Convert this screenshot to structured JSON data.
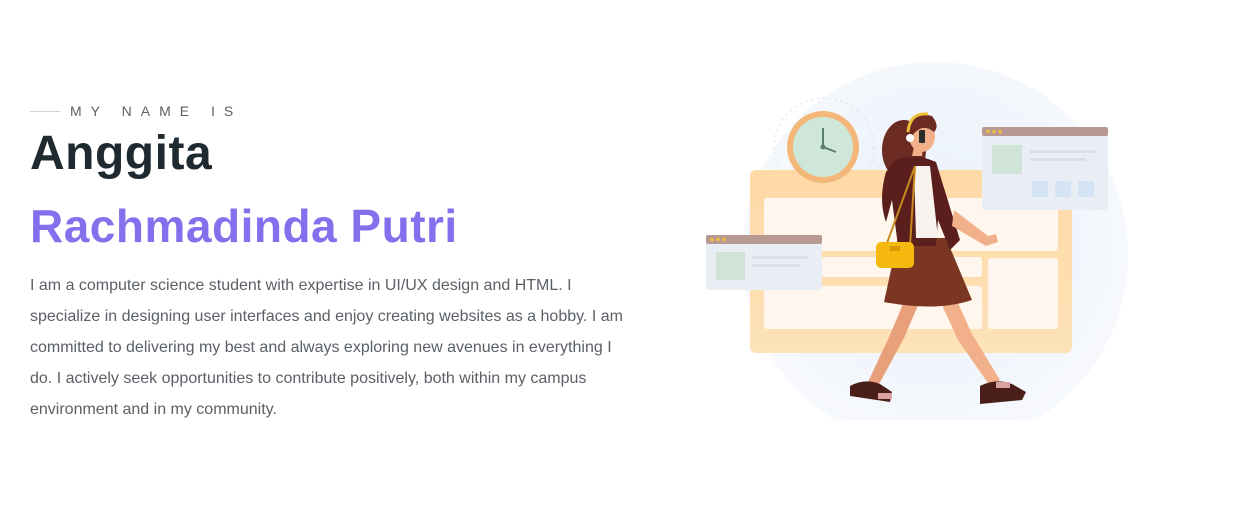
{
  "hero": {
    "eyebrow": "MY NAME IS",
    "first_name": "Anggita",
    "last_name": "Rachmadinda Putri",
    "bio": "I am a computer science student with expertise in UI/UX design and HTML. I specialize in designing user interfaces and enjoy creating websites as a hobby. I am committed to delivering my best and always exploring new avenues in everything I do. I actively seek opportunities to contribute positively, both within my campus environment and in my community."
  },
  "illustration": {
    "icon": "woman-walking-phone-illustration",
    "accent_color": "#8370ec",
    "heading_color": "#1f2930"
  }
}
